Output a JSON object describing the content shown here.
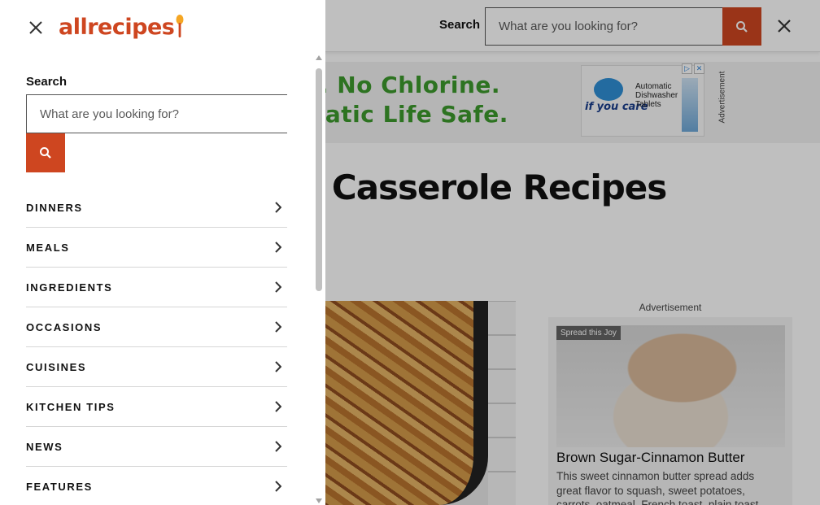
{
  "brand": {
    "logo_text": "allrecipes",
    "accent_color": "#ce4620",
    "logo_icon": "spoon-icon"
  },
  "drawer": {
    "close_icon": "close-icon",
    "search_label": "Search",
    "search_placeholder": "What are you looking for?",
    "search_button_icon": "search-icon",
    "nav_items": [
      {
        "label": "DINNERS"
      },
      {
        "label": "MEALS"
      },
      {
        "label": "INGREDIENTS"
      },
      {
        "label": "OCCASIONS"
      },
      {
        "label": "CUISINES"
      },
      {
        "label": "KITCHEN TIPS"
      },
      {
        "label": "NEWS"
      },
      {
        "label": "FEATURES"
      }
    ]
  },
  "header": {
    "search_label": "Search",
    "search_placeholder": "What are you looking for?",
    "search_button_icon": "search-icon",
    "close_icon": "close-icon"
  },
  "ad_banner": {
    "line1": "phates. No Chlorine.",
    "line2": "te. Aquatic Life Safe.",
    "brand_text": "if you care",
    "product_text": "Automatic Dishwasher Tablets",
    "label": "Advertisement"
  },
  "main": {
    "heading": "knight Casserole Recipes"
  },
  "side_ad": {
    "label": "Advertisement",
    "tag": "Spread this Joy",
    "title": "Brown Sugar-Cinnamon Butter",
    "description": "This sweet cinnamon butter spread adds great flavor to squash, sweet potatoes, carrots, oatmeal, French toast, plain toast, pancakes"
  }
}
